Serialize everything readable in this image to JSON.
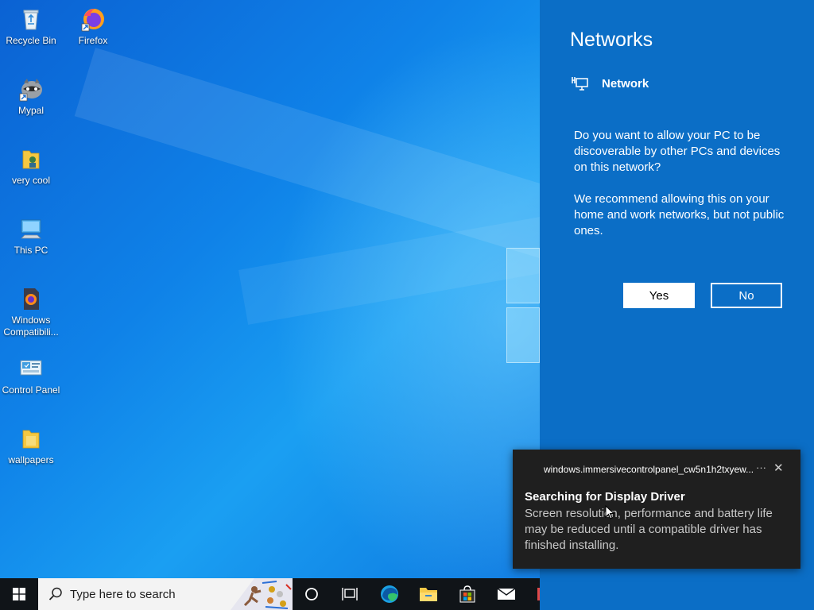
{
  "desktop": {
    "icons": [
      {
        "label": "Recycle Bin",
        "icon": "recycle-bin-icon"
      },
      {
        "label": "Firefox",
        "icon": "firefox-icon"
      },
      {
        "label": "Mypal",
        "icon": "mypal-icon"
      },
      {
        "label": "very cool",
        "icon": "folder-icon"
      },
      {
        "label": "This PC",
        "icon": "this-pc-icon"
      },
      {
        "label": "Windows Compatibili...",
        "icon": "windows-compatibility-icon"
      },
      {
        "label": "Control Panel",
        "icon": "control-panel-icon"
      },
      {
        "label": "wallpapers",
        "icon": "folder-icon"
      }
    ]
  },
  "networks_panel": {
    "title": "Networks",
    "network_name": "Network",
    "network_icon": "ethernet-icon",
    "question": "Do you want to allow your PC to be discoverable by other PCs and devices on this network?",
    "recommendation": "We recommend allowing this on your home and work networks, but not public ones.",
    "yes_label": "Yes",
    "no_label": "No",
    "background": "#0b6ec6"
  },
  "toast": {
    "app_name": "windows.immersivecontrolpanel_cw5n1h2txyew...",
    "more_label": "···",
    "close_label": "✕",
    "title": "Searching for Display Driver",
    "body": "Screen resolution, performance and battery life may be reduced until a compatible driver has finished installing."
  },
  "taskbar": {
    "search_placeholder": "Type here to search",
    "items": [
      "start-icon",
      "search-icon",
      "cortana-icon",
      "task-view-icon",
      "edge-icon",
      "file-explorer-icon",
      "microsoft-store-icon",
      "mail-icon"
    ],
    "accent": "#76b9ed"
  }
}
